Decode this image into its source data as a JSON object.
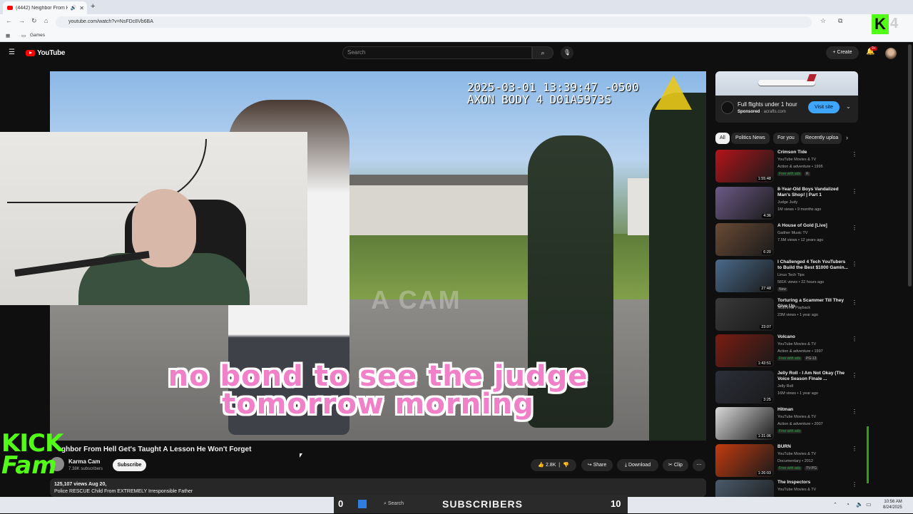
{
  "browser": {
    "tab_title": "(4442) Neighbor From Hell",
    "url": "youtube.com/watch?v=NsFDc8Vb6BA",
    "bookmark": "Games"
  },
  "header": {
    "logo_text": "YouTube",
    "search_placeholder": "Search",
    "create_label": "Create",
    "notifications_badge": "9+"
  },
  "video": {
    "timestamp_line1": "2025-03-01 13:39:47 -0500",
    "timestamp_line2": "AXON BODY 4 D01A5973S",
    "watermark": "A CAM",
    "caption_line1": "no bond to see the judge",
    "caption_line2": "tomorrow morning",
    "title": "ghbor From Hell Get's Taught A Lesson He Won't Forget",
    "channel": "Karma Cam",
    "subscribers": "7.38K subscribers",
    "subscribe_label": "Subscribe",
    "likes": "2.8K",
    "share_label": "Share",
    "download_label": "Download",
    "clip_label": "Clip",
    "views_date": "125,107 views  Aug 20,",
    "description": "Police RESCUE Child From EXTREMELY Irresponsible Father"
  },
  "ad": {
    "title": "Full flights under 1 hour",
    "sponsored": "Sponsored",
    "domain": "· acrafts.com",
    "visit_label": "Visit site"
  },
  "chips": [
    "All",
    "Politics News",
    "For you",
    "Recently uploa"
  ],
  "recommendations": [
    {
      "title": "Crimson Tide",
      "channel": "YouTube Movies & TV",
      "meta": "Action & adventure • 1995",
      "badge1": "Free with ads",
      "badge2": "R",
      "duration": "1:55:48",
      "color": "#b3141a"
    },
    {
      "title": "8-Year-Old Boys Vandalized Man's Shop! | Part 1",
      "channel": "Judge Judy",
      "meta": "1M views • 9 months ago",
      "duration": "4:36",
      "color": "#6c5a86"
    },
    {
      "title": "A House of Gold [Live]",
      "channel": "Gaither Music TV",
      "meta": "7.5M views • 12 years ago",
      "duration": "6:20",
      "color": "#6a4b36"
    },
    {
      "title": "I Challenged 4 Tech YouTubers to Build the Best $1000 Gamin...",
      "channel": "Linus Tech Tips",
      "meta": "581K views • 22 hours ago",
      "badge1": "New",
      "duration": "27:48",
      "color": "#4a6a8a"
    },
    {
      "title": "Torturing a Scammer Till They Give Up",
      "channel": "Scammer Payback",
      "meta": "23M views • 1 year ago",
      "duration": "23:07",
      "color": "#3a3a3a"
    },
    {
      "title": "Volcano",
      "channel": "YouTube Movies & TV",
      "meta": "Action & adventure • 1997",
      "badge1": "Free with ads",
      "badge2": "PG-13",
      "duration": "1:43:51",
      "color": "#7a1c12"
    },
    {
      "title": "Jelly Roll - I Am Not Okay (The Voice Season Finale ...",
      "channel": "Jelly Roll",
      "meta": "16M views • 1 year ago",
      "duration": "3:25",
      "color": "#2c2f3a"
    },
    {
      "title": "Hitman",
      "channel": "YouTube Movies & TV",
      "meta": "Action & adventure • 2007",
      "badge1": "Free with ads",
      "duration": "1:31:06",
      "color": "#d9d9d9"
    },
    {
      "title": "BURN",
      "channel": "YouTube Movies & TV",
      "meta": "Documentary • 2012",
      "badge1": "Free with ads",
      "badge2": "TV-PG",
      "duration": "1:26:03",
      "color": "#c23b10"
    },
    {
      "title": "The Inspectors",
      "channel": "YouTube Movies & TV",
      "meta": "",
      "duration": "",
      "color": "#4a5a6a"
    }
  ],
  "overlay": {
    "kick_line1": "KICK",
    "kick_line2": "Fam",
    "kick_corner": "K",
    "kick_count": "4",
    "left_number": "0",
    "right_number": "10",
    "subscribers_text": "SUBSCRIBERS"
  },
  "taskbar": {
    "search": "Search",
    "time": "10:56 AM",
    "date": "8/24/2025"
  }
}
